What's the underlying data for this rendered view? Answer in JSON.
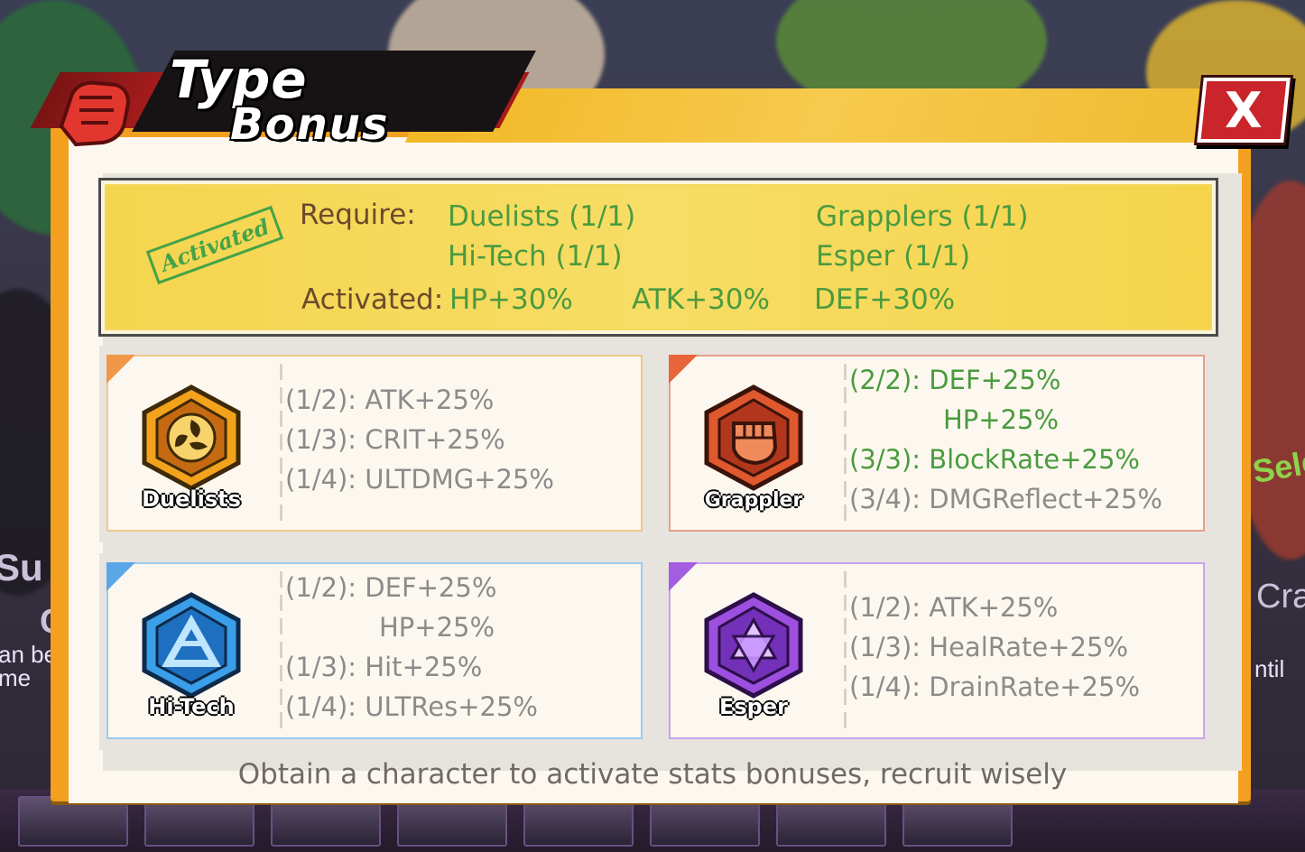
{
  "header": {
    "title_line1": "Type",
    "title_line2": "Bonus",
    "close_label": "X"
  },
  "activated": {
    "stamp": "Activated",
    "require_label": "Require:",
    "requirements": [
      "Duelists (1/1)",
      "Grapplers (1/1)",
      "Hi-Tech (1/1)",
      "Esper (1/1)"
    ],
    "activated_label": "Activated:",
    "bonuses": [
      "HP+30%",
      "ATK+30%",
      "DEF+30%"
    ]
  },
  "types": [
    {
      "name": "Duelists",
      "accent": "#f0974a",
      "lines": [
        {
          "text": "(1/2): ATK+25%",
          "active": false
        },
        {
          "text": "(1/3): CRIT+25%",
          "active": false
        },
        {
          "text": "(1/4): ULTDMG+25%",
          "active": false
        }
      ]
    },
    {
      "name": "Grappler",
      "accent": "#e8643a",
      "lines": [
        {
          "text": "(2/2): DEF+25%",
          "active": true
        },
        {
          "text": "HP+25%",
          "active": true,
          "indent": true
        },
        {
          "text": "(3/3): BlockRate+25%",
          "active": true
        },
        {
          "text": "(3/4): DMGReflect+25%",
          "active": false
        }
      ]
    },
    {
      "name": "Hi-Tech",
      "accent": "#5aa6e6",
      "lines": [
        {
          "text": "(1/2): DEF+25%",
          "active": false
        },
        {
          "text": "HP+25%",
          "active": false,
          "indent": true
        },
        {
          "text": "(1/3): Hit+25%",
          "active": false
        },
        {
          "text": "(1/4): ULTRes+25%",
          "active": false
        }
      ]
    },
    {
      "name": "Esper",
      "accent": "#a35de0",
      "lines": [
        {
          "text": "(1/2): ATK+25%",
          "active": false
        },
        {
          "text": "(1/3): HealRate+25%",
          "active": false
        },
        {
          "text": "(1/4): DrainRate+25%",
          "active": false
        }
      ]
    }
  ],
  "footer": "Obtain a character to activate stats bonuses, recruit wisely",
  "background_fragments": [
    "Su",
    "C",
    "an be",
    "me",
    "Sele",
    "Cra",
    "ntil"
  ]
}
